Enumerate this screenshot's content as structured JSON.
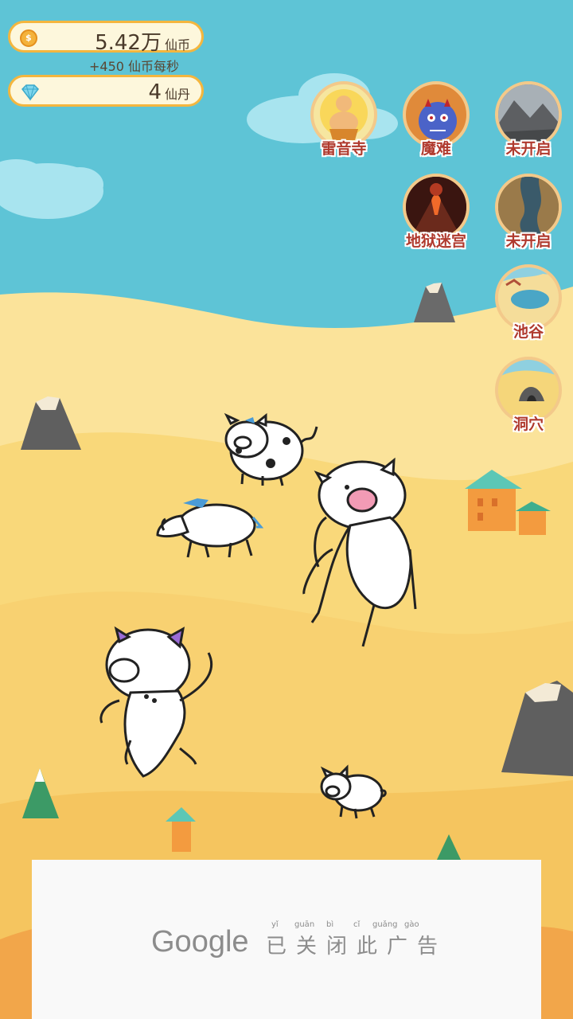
{
  "currency": {
    "coin_value": "5.42万",
    "coin_unit": "仙币",
    "rate": "+450 仙币每秒",
    "gem_value": "4",
    "gem_unit": "仙丹",
    "coin_icon": "coin-icon",
    "gem_icon": "diamond-icon"
  },
  "maps": [
    {
      "label": "雷音寺",
      "icon": "buddha-icon"
    },
    {
      "label": "魔难",
      "icon": "demon-icon"
    },
    {
      "label": "未开启",
      "icon": "rocks-icon"
    },
    {
      "label": "地狱迷宫",
      "icon": "volcano-icon"
    },
    {
      "label": "未开启",
      "icon": "river-icon"
    },
    {
      "label": "池谷",
      "icon": "pond-icon"
    },
    {
      "label": "洞穴",
      "icon": "cave-icon"
    }
  ],
  "ad": {
    "brand": "Google",
    "closed_text": "已关闭此广告",
    "pinyin": [
      "yǐ",
      "guān",
      "bì",
      "cǐ",
      "guǎng",
      "gào"
    ]
  },
  "colors": {
    "sky": "#5ec4d6",
    "sand": "#f8d171",
    "sand_dark": "#f4c05b",
    "accent_border": "#f4b63e",
    "label_red": "#b03a2e"
  }
}
